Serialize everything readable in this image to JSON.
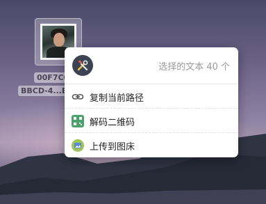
{
  "desktop_file": {
    "name_line1": "00F7C0",
    "name_line2": "BBCD-4...E"
  },
  "context_menu": {
    "header_text": "选择的文本 40 个",
    "items": [
      {
        "label": "复制当前路径",
        "icon": "link-icon"
      },
      {
        "label": "解码二维码",
        "icon": "qr-code-icon"
      },
      {
        "label": "上传到图床",
        "icon": "upload-image-icon"
      }
    ]
  }
}
